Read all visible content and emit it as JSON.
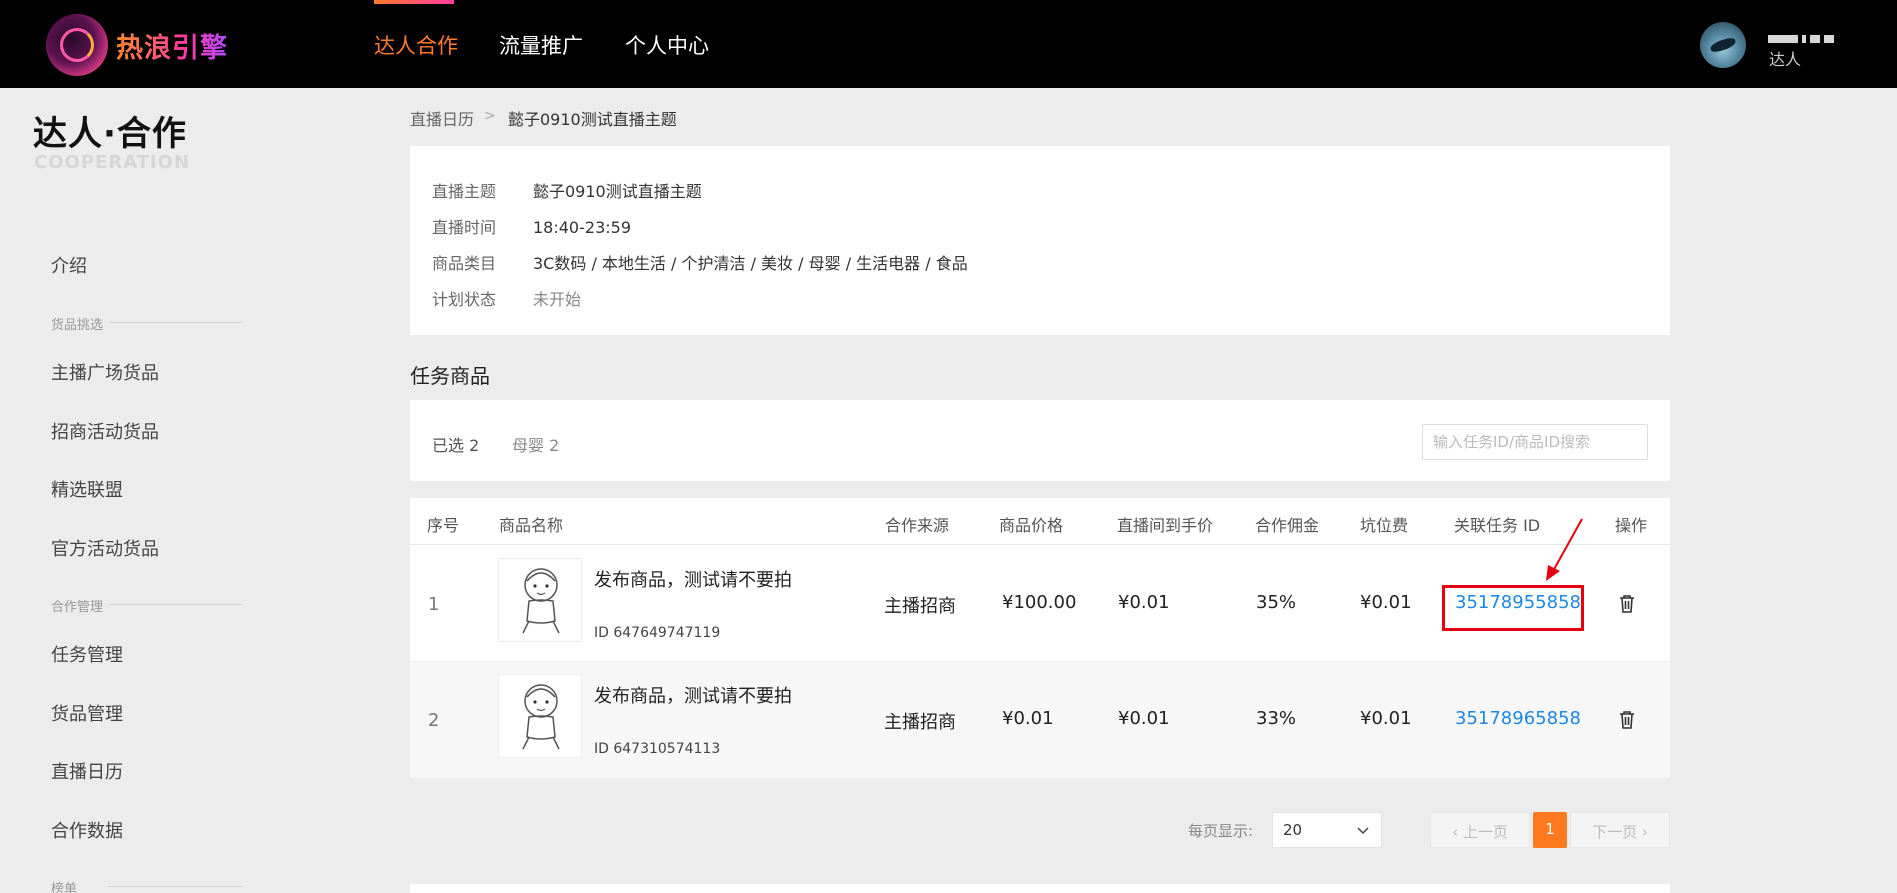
{
  "app": {
    "logo_text": "热浪引擎",
    "user_role": "达人"
  },
  "nav": {
    "items": [
      "达人合作",
      "流量推广",
      "个人中心"
    ],
    "active_color": "#ff7a2a"
  },
  "sidebar": {
    "title": "达人·合作",
    "subtitle": "COOPERATION",
    "intro": "介绍",
    "groups": [
      {
        "label": "货品挑选",
        "items": [
          "主播广场货品",
          "招商活动货品",
          "精选联盟",
          "官方活动货品"
        ]
      },
      {
        "label": "合作管理",
        "items": [
          "任务管理",
          "货品管理",
          "直播日历",
          "合作数据"
        ]
      },
      {
        "label": "榜单",
        "items": []
      }
    ]
  },
  "breadcrumb": {
    "parent": "直播日历",
    "separator": ">",
    "current": "懿子0910测试直播主题"
  },
  "live_info": {
    "rows": [
      {
        "label": "直播主题",
        "value": "懿子0910测试直播主题"
      },
      {
        "label": "直播时间",
        "value": "18:40-23:59"
      },
      {
        "label": "商品类目",
        "value": "3C数码 / 本地生活 / 个护清洁 / 美妆 / 母婴 / 生活电器 / 食品"
      },
      {
        "label": "计划状态",
        "value": "未开始"
      }
    ]
  },
  "task_goods": {
    "title": "任务商品",
    "filter_selected": "已选 2",
    "filter_category": "母婴 2",
    "search_placeholder": "输入任务ID/商品ID搜索",
    "columns": [
      "序号",
      "商品名称",
      "合作来源",
      "商品价格",
      "直播间到手价",
      "合作佣金",
      "坑位费",
      "关联任务 ID",
      "操作"
    ],
    "rows": [
      {
        "index": "1",
        "name": "发布商品，测试请不要拍",
        "id": "ID 647649747119",
        "source": "主播招商",
        "price": "¥100.00",
        "live_price": "¥0.01",
        "commission": "35%",
        "slot_fee": "¥0.01",
        "task_id": "35178955858"
      },
      {
        "index": "2",
        "name": "发布商品，测试请不要拍",
        "id": "ID 647310574113",
        "source": "主播招商",
        "price": "¥0.01",
        "live_price": "¥0.01",
        "commission": "33%",
        "slot_fee": "¥0.01",
        "task_id": "35178965858"
      }
    ]
  },
  "pagination": {
    "per_page_label": "每页显示:",
    "per_page_value": "20",
    "prev": "上一页",
    "next": "下一页",
    "current_page": "1",
    "accent": "#ff7a1f"
  },
  "annotation": {
    "highlight_color": "#e60012"
  }
}
